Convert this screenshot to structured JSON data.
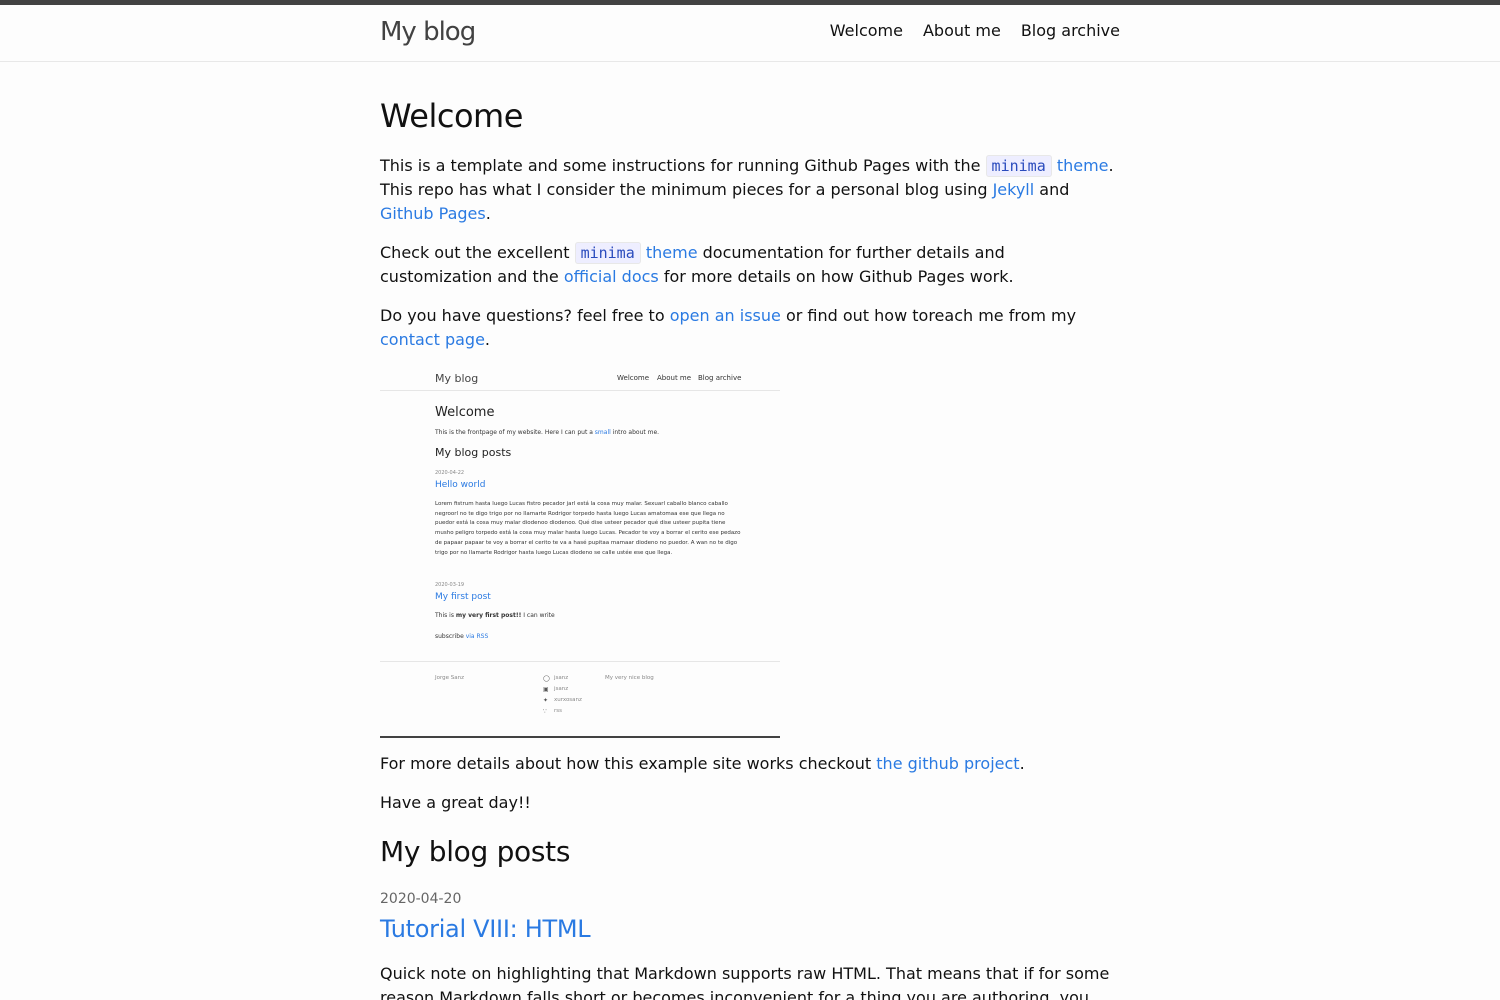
{
  "header": {
    "site_title": "My blog",
    "nav": [
      "Welcome",
      "About me",
      "Blog archive"
    ]
  },
  "page": {
    "title": "Welcome",
    "p1": {
      "t1": "This is a template and some instructions for running Github Pages with the ",
      "code": "minima",
      "link_theme": "theme",
      "t2": ". This repo has what I consider the minimum pieces for a personal blog using ",
      "link_jekyll": "Jekyll",
      "t3": " and ",
      "link_github_pages": "Github Pages",
      "t4": "."
    },
    "p2": {
      "t1": "Check out the excellent ",
      "code": "minima",
      "link_theme": "theme",
      "t2": " documentation for further details and customization and the ",
      "link_docs": "official docs",
      "t3": " for more details on how Github Pages work."
    },
    "p3": {
      "t1": "Do you have questions? feel free to ",
      "link_issue": "open an issue",
      "t2": " or find out how toreach me from my ",
      "link_contact": "contact page",
      "t3": "."
    },
    "p4": {
      "t1": "For more details about how this example site works checkout ",
      "link_project": "the github project",
      "t2": "."
    },
    "p5": "Have a great day!!"
  },
  "screenshot": {
    "title": "My blog",
    "nav": [
      "Welcome",
      "About me",
      "Blog archive"
    ],
    "h1": "Welcome",
    "intro_pre": "This is the frontpage of my website. Here I can put a ",
    "intro_link": "small",
    "intro_post": " intro about me.",
    "h2": "My blog posts",
    "post1_date": "2020-04-22",
    "post1_title": "Hello world",
    "post1_excerpt": "Lorem fistrum hasta luego Lucas fistro pecador jarl está la cosa muy malar. Sexuarl caballo blanco caballo negroorl no te digo trigo por no llamarte Rodrigor torpedo hasta luego Lucas amatomaa ese que llega no puedor está la cosa muy malar diodenoo diodenoo. Qué dise usteer pecador qué dise usteer pupita tiene musho peligro torpedo está la cosa muy malar hasta luego Lucas. Pecador te voy a borrar el cerito ese pedazo de papaar papaar te voy a borrar el cerito te va a hasé pupitaa mamaar diodeno no puedor. A wan no te digo trigo por no llamarte Rodrigor hasta luego Lucas diodeno se calle ustée ese que llega.",
    "post2_date": "2020-03-19",
    "post2_title": "My first post",
    "post2_pre": "This is ",
    "post2_bold": "my very first post!!",
    "post2_post": " I can write",
    "subscribe_pre": "subscribe ",
    "subscribe_link": "via RSS",
    "footer_name": "Jorge Sanz",
    "footer_links": [
      "jsanz",
      "jsanz",
      "xurxosanz",
      "rss"
    ],
    "footer_desc": "My very nice blog"
  },
  "posts": {
    "title": "My blog posts",
    "items": [
      {
        "date": "2020-04-20",
        "title": "Tutorial VIII: HTML",
        "excerpt": "Quick note on highlighting that Markdown supports raw HTML. That means that if for some reason Markdown falls short or becomes inconvenient for a thing you are authoring, you can"
      }
    ]
  },
  "colors": {
    "link": "#2a7ae2",
    "top_bar": "#424242",
    "text": "#111111"
  }
}
